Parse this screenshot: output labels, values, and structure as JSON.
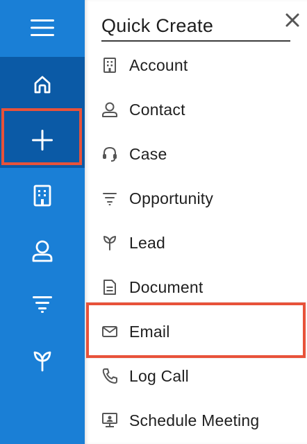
{
  "sidebar": {
    "items": [
      {
        "name": "menu",
        "icon": "hamburger-menu-icon"
      },
      {
        "name": "home",
        "icon": "home-icon"
      },
      {
        "name": "quick-create",
        "icon": "plus-icon"
      },
      {
        "name": "accounts",
        "icon": "building-icon"
      },
      {
        "name": "contacts",
        "icon": "person-icon"
      },
      {
        "name": "opportunities",
        "icon": "funnel-icon"
      },
      {
        "name": "leads",
        "icon": "sprout-icon"
      }
    ],
    "background": "#1a7fd6",
    "active_background": "#0b5aa6"
  },
  "panel": {
    "title": "Quick Create",
    "close_icon": "close-icon",
    "items": [
      {
        "label": "Account",
        "icon": "building-icon"
      },
      {
        "label": "Contact",
        "icon": "person-icon"
      },
      {
        "label": "Case",
        "icon": "headset-icon"
      },
      {
        "label": "Opportunity",
        "icon": "funnel-icon"
      },
      {
        "label": "Lead",
        "icon": "sprout-icon"
      },
      {
        "label": "Document",
        "icon": "document-icon"
      },
      {
        "label": "Email",
        "icon": "envelope-icon"
      },
      {
        "label": "Log Call",
        "icon": "phone-icon"
      },
      {
        "label": "Schedule Meeting",
        "icon": "presentation-icon"
      }
    ]
  },
  "highlight_color": "#e8523a"
}
